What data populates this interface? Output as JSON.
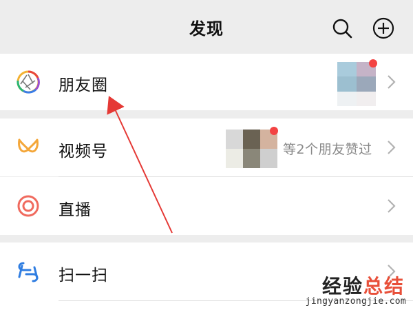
{
  "header": {
    "title": "发现",
    "search_icon": "search-icon",
    "add_icon": "add-circle-icon"
  },
  "menu": [
    {
      "id": "moments",
      "icon": "moments-aperture-icon",
      "label": "朋友圈",
      "has_thumbnail": true,
      "has_unread_dot": true
    },
    {
      "id": "channels",
      "icon": "channels-butterfly-icon",
      "label": "视频号",
      "meta": "等2个朋友赞过",
      "has_thumbnail": true,
      "has_unread_dot": true
    },
    {
      "id": "live",
      "icon": "live-ring-icon",
      "label": "直播"
    },
    {
      "id": "scan",
      "icon": "scan-icon",
      "label": "扫一扫"
    }
  ],
  "annotation": {
    "arrow_color": "#e53935",
    "target": "朋友圈"
  },
  "watermark": {
    "cn_a": "经验",
    "cn_b": "总结",
    "en": "jingyanzongjie.com"
  },
  "colors": {
    "background": "#ededed",
    "row_background": "#ffffff",
    "unread_dot": "#f34343",
    "chevron": "#b2b2b2",
    "live_icon": "#f06a5e",
    "channels_icon": "#f4a73a",
    "scan_icon": "#2f7de1"
  }
}
